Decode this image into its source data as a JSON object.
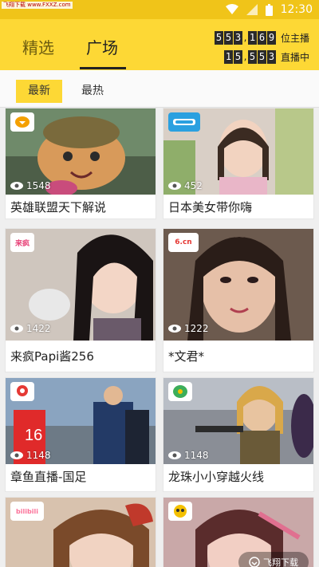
{
  "statusbar": {
    "watermark": "飞翔下载 www.FXXZ.com",
    "time": "12:30"
  },
  "header": {
    "tabs": [
      {
        "label": "精选"
      },
      {
        "label": "广场"
      }
    ],
    "counters": [
      {
        "digits": [
          "5",
          "5",
          "3",
          ",",
          "1",
          "6",
          "9"
        ],
        "label": "位主播"
      },
      {
        "digits": [
          "1",
          "5",
          ",",
          "5",
          "5",
          "3"
        ],
        "label": "直播中"
      }
    ]
  },
  "filters": [
    {
      "label": "最新"
    },
    {
      "label": "最热"
    }
  ],
  "cards": [
    {
      "title": "英雄联盟天下解说",
      "viewers": "1548",
      "badge": "",
      "badge_color": "#f4a000"
    },
    {
      "title": "日本美女带你嗨",
      "viewers": "452",
      "badge": "",
      "badge_color": "#2aa0e0"
    },
    {
      "title": "来疯Papi酱256",
      "viewers": "1422",
      "badge": "来疯",
      "badge_color": "#e8457a"
    },
    {
      "title": "*文君*",
      "viewers": "1222",
      "badge": "6.cn",
      "badge_color": "#e53935"
    },
    {
      "title": "章鱼直播-国足",
      "viewers": "1148",
      "badge": "",
      "badge_color": "#e53935"
    },
    {
      "title": "龙珠小小穿越火线",
      "viewers": "1148",
      "badge": "",
      "badge_color": "#2e9e4a"
    },
    {
      "title": "",
      "viewers": "",
      "badge": "bilibili",
      "badge_color": "#fb7299"
    },
    {
      "title": "",
      "viewers": "",
      "badge": "",
      "badge_color": "#f4a000"
    }
  ],
  "bottom_watermark": "飞翔下载"
}
